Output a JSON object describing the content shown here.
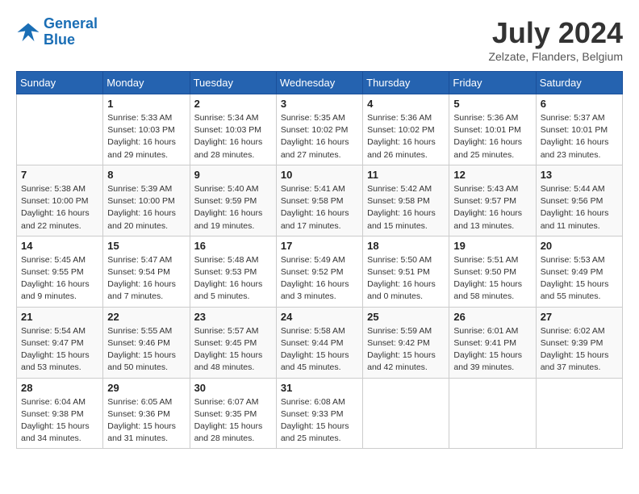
{
  "header": {
    "logo_line1": "General",
    "logo_line2": "Blue",
    "month": "July 2024",
    "location": "Zelzate, Flanders, Belgium"
  },
  "days_of_week": [
    "Sunday",
    "Monday",
    "Tuesday",
    "Wednesday",
    "Thursday",
    "Friday",
    "Saturday"
  ],
  "weeks": [
    [
      {
        "day": "",
        "sunrise": "",
        "sunset": "",
        "daylight": ""
      },
      {
        "day": "1",
        "sunrise": "Sunrise: 5:33 AM",
        "sunset": "Sunset: 10:03 PM",
        "daylight": "Daylight: 16 hours and 29 minutes."
      },
      {
        "day": "2",
        "sunrise": "Sunrise: 5:34 AM",
        "sunset": "Sunset: 10:03 PM",
        "daylight": "Daylight: 16 hours and 28 minutes."
      },
      {
        "day": "3",
        "sunrise": "Sunrise: 5:35 AM",
        "sunset": "Sunset: 10:02 PM",
        "daylight": "Daylight: 16 hours and 27 minutes."
      },
      {
        "day": "4",
        "sunrise": "Sunrise: 5:36 AM",
        "sunset": "Sunset: 10:02 PM",
        "daylight": "Daylight: 16 hours and 26 minutes."
      },
      {
        "day": "5",
        "sunrise": "Sunrise: 5:36 AM",
        "sunset": "Sunset: 10:01 PM",
        "daylight": "Daylight: 16 hours and 25 minutes."
      },
      {
        "day": "6",
        "sunrise": "Sunrise: 5:37 AM",
        "sunset": "Sunset: 10:01 PM",
        "daylight": "Daylight: 16 hours and 23 minutes."
      }
    ],
    [
      {
        "day": "7",
        "sunrise": "Sunrise: 5:38 AM",
        "sunset": "Sunset: 10:00 PM",
        "daylight": "Daylight: 16 hours and 22 minutes."
      },
      {
        "day": "8",
        "sunrise": "Sunrise: 5:39 AM",
        "sunset": "Sunset: 10:00 PM",
        "daylight": "Daylight: 16 hours and 20 minutes."
      },
      {
        "day": "9",
        "sunrise": "Sunrise: 5:40 AM",
        "sunset": "Sunset: 9:59 PM",
        "daylight": "Daylight: 16 hours and 19 minutes."
      },
      {
        "day": "10",
        "sunrise": "Sunrise: 5:41 AM",
        "sunset": "Sunset: 9:58 PM",
        "daylight": "Daylight: 16 hours and 17 minutes."
      },
      {
        "day": "11",
        "sunrise": "Sunrise: 5:42 AM",
        "sunset": "Sunset: 9:58 PM",
        "daylight": "Daylight: 16 hours and 15 minutes."
      },
      {
        "day": "12",
        "sunrise": "Sunrise: 5:43 AM",
        "sunset": "Sunset: 9:57 PM",
        "daylight": "Daylight: 16 hours and 13 minutes."
      },
      {
        "day": "13",
        "sunrise": "Sunrise: 5:44 AM",
        "sunset": "Sunset: 9:56 PM",
        "daylight": "Daylight: 16 hours and 11 minutes."
      }
    ],
    [
      {
        "day": "14",
        "sunrise": "Sunrise: 5:45 AM",
        "sunset": "Sunset: 9:55 PM",
        "daylight": "Daylight: 16 hours and 9 minutes."
      },
      {
        "day": "15",
        "sunrise": "Sunrise: 5:47 AM",
        "sunset": "Sunset: 9:54 PM",
        "daylight": "Daylight: 16 hours and 7 minutes."
      },
      {
        "day": "16",
        "sunrise": "Sunrise: 5:48 AM",
        "sunset": "Sunset: 9:53 PM",
        "daylight": "Daylight: 16 hours and 5 minutes."
      },
      {
        "day": "17",
        "sunrise": "Sunrise: 5:49 AM",
        "sunset": "Sunset: 9:52 PM",
        "daylight": "Daylight: 16 hours and 3 minutes."
      },
      {
        "day": "18",
        "sunrise": "Sunrise: 5:50 AM",
        "sunset": "Sunset: 9:51 PM",
        "daylight": "Daylight: 16 hours and 0 minutes."
      },
      {
        "day": "19",
        "sunrise": "Sunrise: 5:51 AM",
        "sunset": "Sunset: 9:50 PM",
        "daylight": "Daylight: 15 hours and 58 minutes."
      },
      {
        "day": "20",
        "sunrise": "Sunrise: 5:53 AM",
        "sunset": "Sunset: 9:49 PM",
        "daylight": "Daylight: 15 hours and 55 minutes."
      }
    ],
    [
      {
        "day": "21",
        "sunrise": "Sunrise: 5:54 AM",
        "sunset": "Sunset: 9:47 PM",
        "daylight": "Daylight: 15 hours and 53 minutes."
      },
      {
        "day": "22",
        "sunrise": "Sunrise: 5:55 AM",
        "sunset": "Sunset: 9:46 PM",
        "daylight": "Daylight: 15 hours and 50 minutes."
      },
      {
        "day": "23",
        "sunrise": "Sunrise: 5:57 AM",
        "sunset": "Sunset: 9:45 PM",
        "daylight": "Daylight: 15 hours and 48 minutes."
      },
      {
        "day": "24",
        "sunrise": "Sunrise: 5:58 AM",
        "sunset": "Sunset: 9:44 PM",
        "daylight": "Daylight: 15 hours and 45 minutes."
      },
      {
        "day": "25",
        "sunrise": "Sunrise: 5:59 AM",
        "sunset": "Sunset: 9:42 PM",
        "daylight": "Daylight: 15 hours and 42 minutes."
      },
      {
        "day": "26",
        "sunrise": "Sunrise: 6:01 AM",
        "sunset": "Sunset: 9:41 PM",
        "daylight": "Daylight: 15 hours and 39 minutes."
      },
      {
        "day": "27",
        "sunrise": "Sunrise: 6:02 AM",
        "sunset": "Sunset: 9:39 PM",
        "daylight": "Daylight: 15 hours and 37 minutes."
      }
    ],
    [
      {
        "day": "28",
        "sunrise": "Sunrise: 6:04 AM",
        "sunset": "Sunset: 9:38 PM",
        "daylight": "Daylight: 15 hours and 34 minutes."
      },
      {
        "day": "29",
        "sunrise": "Sunrise: 6:05 AM",
        "sunset": "Sunset: 9:36 PM",
        "daylight": "Daylight: 15 hours and 31 minutes."
      },
      {
        "day": "30",
        "sunrise": "Sunrise: 6:07 AM",
        "sunset": "Sunset: 9:35 PM",
        "daylight": "Daylight: 15 hours and 28 minutes."
      },
      {
        "day": "31",
        "sunrise": "Sunrise: 6:08 AM",
        "sunset": "Sunset: 9:33 PM",
        "daylight": "Daylight: 15 hours and 25 minutes."
      },
      {
        "day": "",
        "sunrise": "",
        "sunset": "",
        "daylight": ""
      },
      {
        "day": "",
        "sunrise": "",
        "sunset": "",
        "daylight": ""
      },
      {
        "day": "",
        "sunrise": "",
        "sunset": "",
        "daylight": ""
      }
    ]
  ]
}
